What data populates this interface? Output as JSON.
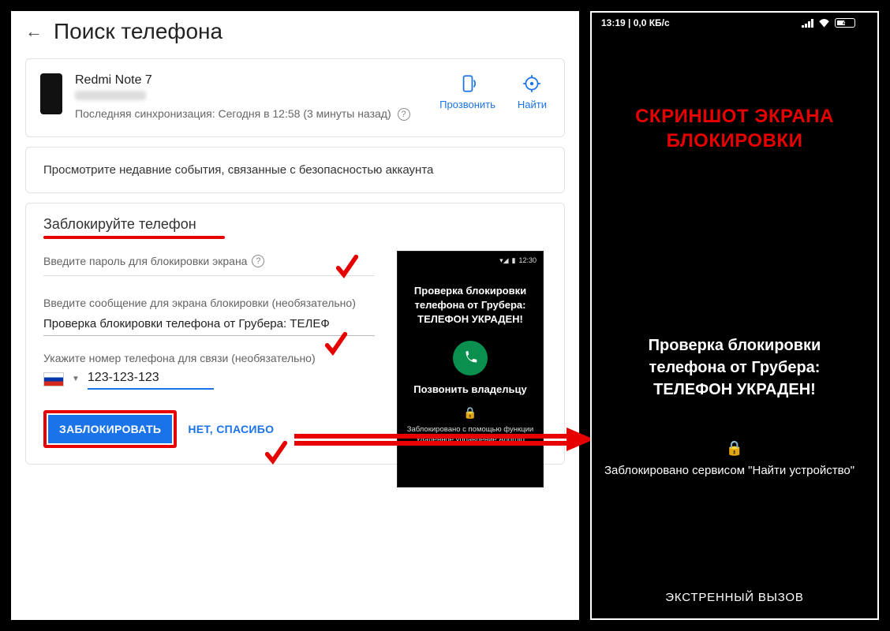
{
  "left": {
    "title": "Поиск телефона",
    "device": {
      "name": "Redmi Note 7",
      "sync": "Последняя синхронизация: Сегодня в 12:58 (3 минуты назад)"
    },
    "actions": {
      "ring": "Прозвонить",
      "find": "Найти"
    },
    "events": "Просмотрите недавние события, связанные с безопасностью аккаунта",
    "lock": {
      "heading": "Заблокируйте телефон",
      "pwd_label": "Введите пароль для блокировки экрана",
      "msg_label": "Введите сообщение для экрана блокировки (необязательно)",
      "msg_value": "Проверка блокировки телефона от Грубера: ТЕЛЕФ",
      "phone_label": "Укажите номер телефона для связи (необязательно)",
      "phone_value": "123-123-123",
      "lock_btn": "ЗАБЛОКИРОВАТЬ",
      "no_thanks": "НЕТ, СПАСИБО"
    },
    "mini": {
      "time": "12:30",
      "msg_l1": "Проверка блокировки",
      "msg_l2": "телефона от Грубера:",
      "msg_l3": "ТЕЛЕФОН УКРАДЕН!",
      "call_owner": "Позвонить владельцу",
      "footer_l1": "Заблокировано с помощью функции",
      "footer_l2": "\"Удаленное управление Android\""
    }
  },
  "right": {
    "status_time": "13:19 | 0,0 КБ/с",
    "batt": "43",
    "title_l1": "Скриншот экрана",
    "title_l2": "блокировки",
    "msg_l1": "Проверка блокировки",
    "msg_l2": "телефона от Грубера:",
    "msg_l3": "ТЕЛЕФОН УКРАДЕН!",
    "locked_by": "Заблокировано сервисом \"Найти устройство\"",
    "emergency": "ЭКСТРЕННЫЙ ВЫЗОВ"
  }
}
